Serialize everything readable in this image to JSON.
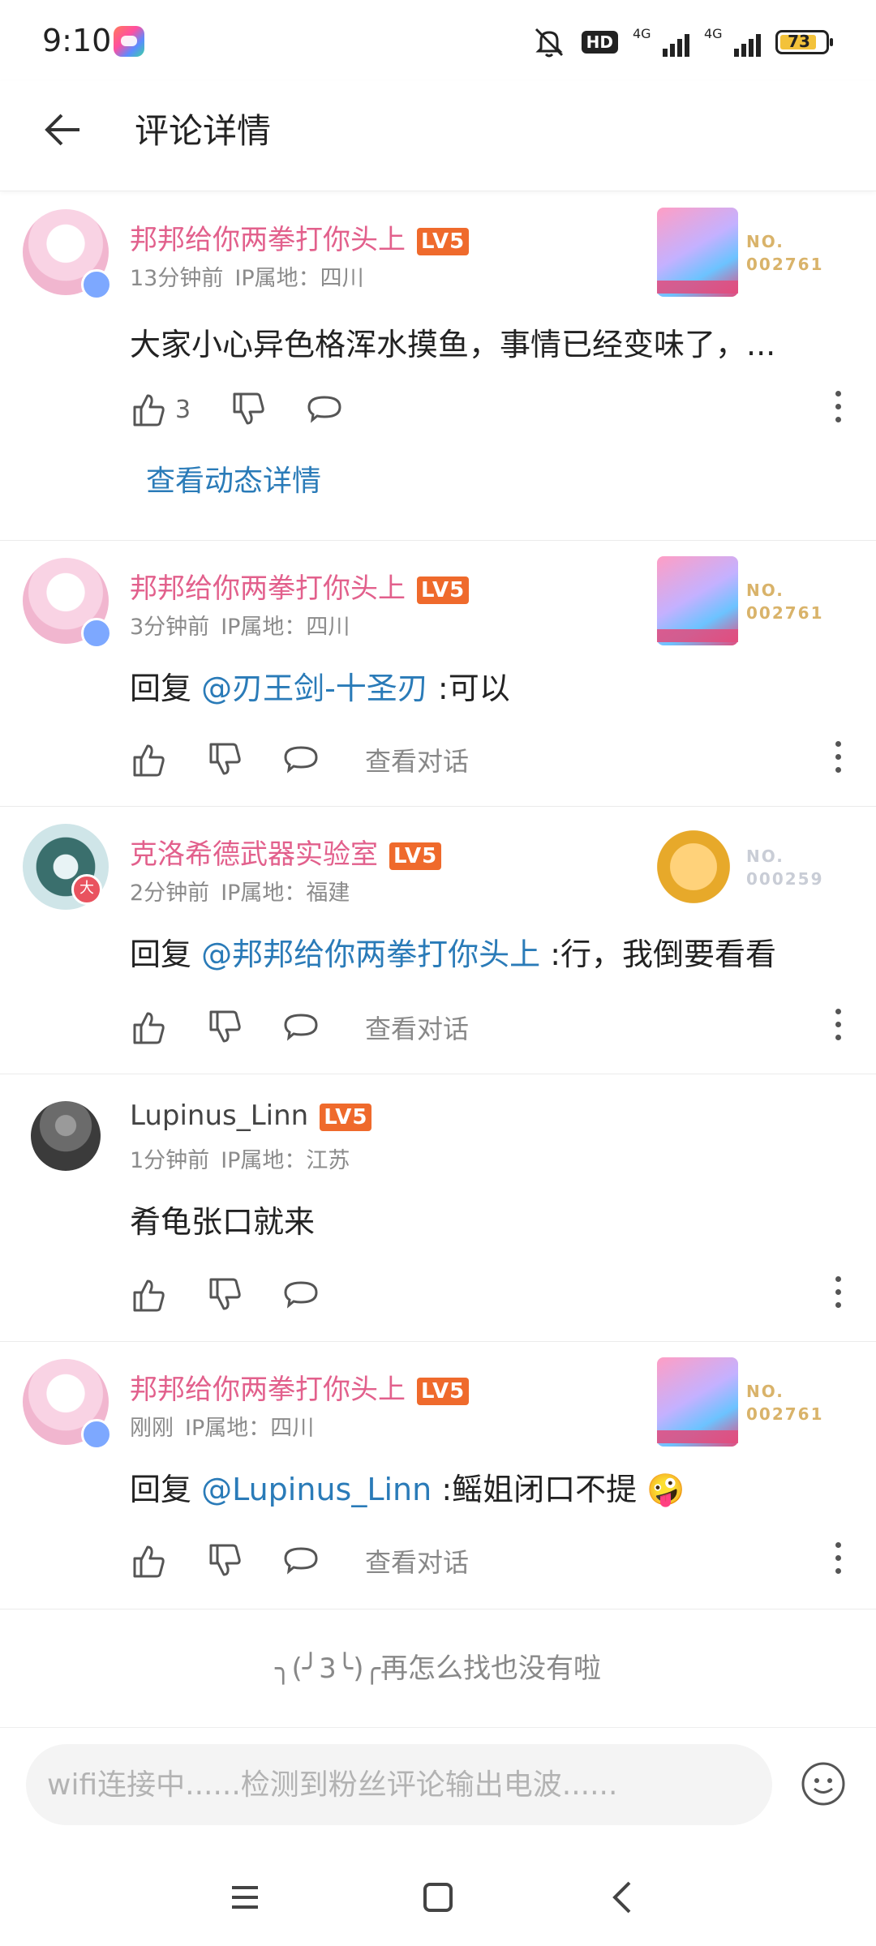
{
  "status_bar": {
    "time": "9:10",
    "hd_label": "HD",
    "network_1": "4G",
    "network_2": "4G",
    "battery": "73"
  },
  "header": {
    "title": "评论详情"
  },
  "comments": [
    {
      "user": "邦邦给你两拳打你头上",
      "level": "LV5",
      "time": "13分钟前",
      "ip": "IP属地：四川",
      "text": "大家小心异色格浑水摸鱼，事情已经变味了，...",
      "like_count": "3",
      "detail_link": "查看动态详情",
      "medal_no": "NO.",
      "medal_num": "002761"
    },
    {
      "user": "邦邦给你两拳打你头上",
      "level": "LV5",
      "time": "3分钟前",
      "ip": "IP属地：四川",
      "reply_prefix": "回复 ",
      "reply_to": "@刃王剑-十圣刃",
      "reply_text": " :可以",
      "view_conversation": "查看对话",
      "medal_no": "NO.",
      "medal_num": "002761"
    },
    {
      "user": "克洛希德武器实验室",
      "level": "LV5",
      "time": "2分钟前",
      "ip": "IP属地：福建",
      "reply_prefix": "回复 ",
      "reply_to": "@邦邦给你两拳打你头上",
      "reply_text": " :行，我倒要看看",
      "view_conversation": "查看对话",
      "medal_no": "NO.",
      "medal_num": "000259",
      "avatar_badge": "大"
    },
    {
      "user": "Lupinus_Linn",
      "level": "LV5",
      "time": "1分钟前",
      "ip": "IP属地：江苏",
      "text": "肴龟张口就来"
    },
    {
      "user": "邦邦给你两拳打你头上",
      "level": "LV5",
      "time": "刚刚",
      "ip": "IP属地：四川",
      "reply_prefix": "回复 ",
      "reply_to": "@Lupinus_Linn",
      "reply_text": " :鳐姐闭口不提 🤪",
      "view_conversation": "查看对话",
      "medal_no": "NO.",
      "medal_num": "002761"
    }
  ],
  "end_text": "╮(╯3╰)╭再怎么找也没有啦",
  "input": {
    "placeholder": "wifi连接中......检测到粉丝评论输出电波......"
  },
  "colors": {
    "username_pink": "#e2608c",
    "link_blue": "#2a7bb8",
    "level_orange": "#ef6a2c"
  },
  "icons": [
    "back-arrow-icon",
    "thumb-up-icon",
    "thumb-down-icon",
    "comment-bubble-icon",
    "more-vertical-icon",
    "emoji-icon",
    "menu-icon",
    "home-square-icon",
    "back-chevron-icon"
  ]
}
